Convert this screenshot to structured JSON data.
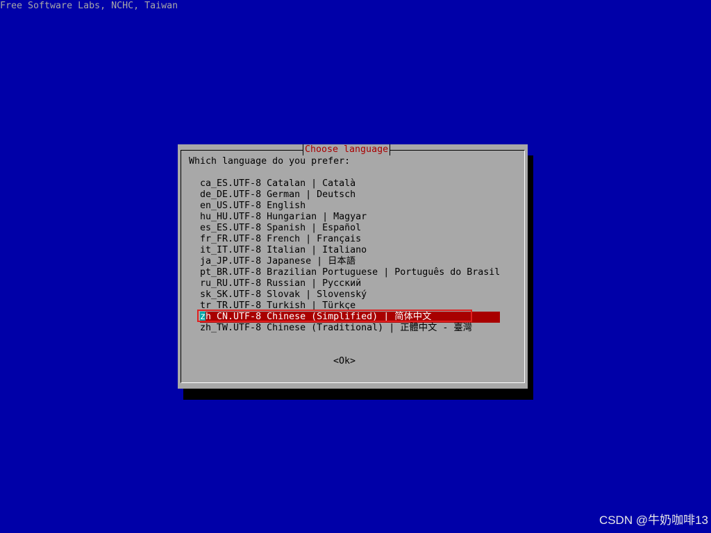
{
  "backtitle": "Free Software Labs, NCHC, Taiwan",
  "dialog": {
    "title": "Choose language",
    "prompt": "Which language do you prefer:",
    "selected_index": 12,
    "items": [
      {
        "code": "ca_ES.UTF-8",
        "label": "Catalan | Català"
      },
      {
        "code": "de_DE.UTF-8",
        "label": "German | Deutsch"
      },
      {
        "code": "en_US.UTF-8",
        "label": "English"
      },
      {
        "code": "hu_HU.UTF-8",
        "label": "Hungarian | Magyar"
      },
      {
        "code": "es_ES.UTF-8",
        "label": "Spanish | Español"
      },
      {
        "code": "fr_FR.UTF-8",
        "label": "French | Français"
      },
      {
        "code": "it_IT.UTF-8",
        "label": "Italian | Italiano"
      },
      {
        "code": "ja_JP.UTF-8",
        "label": "Japanese | 日本語"
      },
      {
        "code": "pt_BR.UTF-8",
        "label": "Brazilian Portuguese | Português do Brasil"
      },
      {
        "code": "ru_RU.UTF-8",
        "label": "Russian | Русский"
      },
      {
        "code": "sk_SK.UTF-8",
        "label": "Slovak | Slovenský"
      },
      {
        "code": "tr_TR.UTF-8",
        "label": "Turkish | Türkçe"
      },
      {
        "code": "zh_CN.UTF-8",
        "label": "Chinese (Simplified) | 简体中文"
      },
      {
        "code": "zh_TW.UTF-8",
        "label": "Chinese (Traditional) | 正體中文 - 臺灣"
      }
    ],
    "ok_label": "<Ok>"
  },
  "watermark": "CSDN @牛奶咖啡13",
  "colors": {
    "background": "#0000a8",
    "dialog": "#a8a8a8",
    "title": "#a80000",
    "selection": "#a80000",
    "cursor": "#00a8a8",
    "highlight_outline": "#e02020"
  }
}
